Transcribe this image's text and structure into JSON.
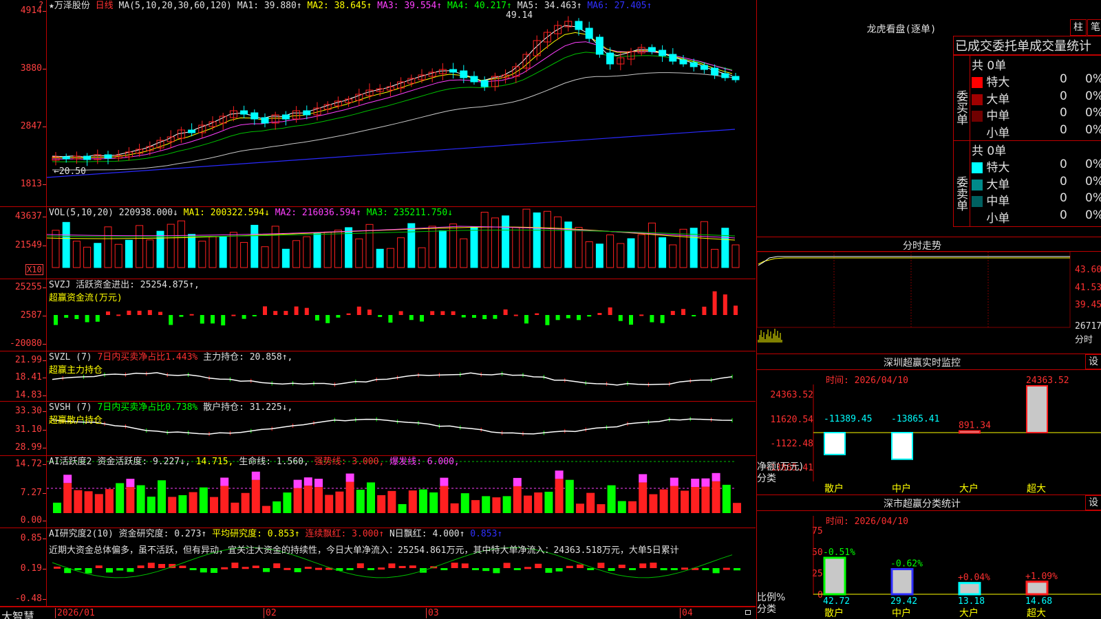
{
  "stock": {
    "star": "★",
    "name": "万泽股份",
    "period": "日线"
  },
  "kline": {
    "ma_label": "MA(5,10,20,30,60,120)",
    "ma1": "MA1: 39.880↑",
    "ma2": "MA2: 38.645↑",
    "ma3": "MA3: 39.554↑",
    "ma4": "MA4: 40.217↑",
    "ma5": "MA5: 34.463↑",
    "ma6": "MA6: 27.405↑",
    "yticks": [
      "4914",
      "3880",
      "2847",
      "1813"
    ],
    "top_icon": "?",
    "high_mark": "49.14",
    "low_mark": "←20.50"
  },
  "vol": {
    "label": "VOL(5,10,20)",
    "value": "220938.000↓",
    "ma1": "MA1: 200322.594↓",
    "ma2": "MA2: 216036.594↑",
    "ma3": "MA3: 235211.750↓",
    "yticks": [
      "43637",
      "21549"
    ],
    "unit": "X10"
  },
  "svzj": {
    "line1": "SVZJ  活跃资金进出: 25254.875↑,",
    "line2": "超赢资金流(万元)",
    "yticks": [
      "25255",
      "2587",
      "-20080"
    ]
  },
  "svzl": {
    "label": "SVZL (7)",
    "desc": "7日内买卖净占比1.443%",
    "value": "主力持仓: 20.858↑,",
    "line2": "超赢主力持仓",
    "yticks": [
      "21.99",
      "18.41",
      "14.83"
    ]
  },
  "svsh": {
    "label": "SVSH (7)",
    "desc": "7日内买卖净占比0.738%",
    "value": "散户持仓: 31.225↓,",
    "line2": "超赢散户持仓",
    "yticks": [
      "33.30",
      "31.10",
      "28.99"
    ]
  },
  "ai_active": {
    "label": "AI活跃度2",
    "v1": "资金活跃度: 9.227↓,",
    "v2": "14.715,",
    "v3": "生命线: 1.560,",
    "v4": "强势线: 3.000,",
    "v5": "爆发线: 6.000,",
    "yticks": [
      "14.72",
      "7.27",
      "0.00"
    ]
  },
  "ai_research": {
    "label": "AI研究度2(10)",
    "v1": "资金研究度: 0.273↑",
    "v2": "平均研究度: 0.853↑",
    "v3": "连续飘红: 3.000↑",
    "v4": "N日飘红: 4.000↑",
    "v5": "0.853↑",
    "comment": "近期大资金总体偏多，虽不活跃，但有异动，宜关注大资金的持续性，今日大单净流入：25254.861万元，其中特大单净流入：24363.518万元，大单5日累计",
    "yticks": [
      "0.85",
      "0.19",
      "-0.48"
    ]
  },
  "xaxis": {
    "corner": "大智慧",
    "dates": [
      "2026/01",
      "02",
      "03",
      "04"
    ]
  },
  "lhkp": {
    "title": "龙虎看盘(逐单)",
    "btn1": "柱",
    "btn2": "笔",
    "tabs": "已成交委托单成交量统计",
    "buy_label": "委买单",
    "sell_label": "委卖单",
    "buy_total": "共 0单",
    "sell_total": "共 0单",
    "buy_rows": [
      {
        "name": "特大",
        "n": "0",
        "p": "0%",
        "color": "#ff0000"
      },
      {
        "name": "大单",
        "n": "0",
        "p": "0%",
        "color": "#a00000"
      },
      {
        "name": "中单",
        "n": "0",
        "p": "0%",
        "color": "#700000"
      },
      {
        "name": "小单",
        "n": "0",
        "p": "0%",
        "color": "#000000"
      }
    ],
    "sell_rows": [
      {
        "name": "特大",
        "n": "0",
        "p": "0%",
        "color": "#00ffff"
      },
      {
        "name": "大单",
        "n": "0",
        "p": "0%",
        "color": "#008a8a"
      },
      {
        "name": "中单",
        "n": "0",
        "p": "0%",
        "color": "#006060"
      },
      {
        "name": "小单",
        "n": "0",
        "p": "0%",
        "color": "#000000"
      }
    ]
  },
  "fenshi": {
    "title": "分时走势",
    "prices": [
      "43.60",
      "41.53",
      "39.45"
    ],
    "vol": "26717",
    "vol_label": "分时"
  },
  "sz_monitor": {
    "title": "深圳超赢实时监控",
    "set": "设",
    "time": "时间: 2026/04/10",
    "yticks": [
      "24363.52",
      "11620.54",
      "-1122.48",
      "-13865.41"
    ],
    "ylabel": "净额(万元)",
    "xlabel": "分类",
    "cats": [
      "散户",
      "中户",
      "大户",
      "超大"
    ],
    "values": [
      "-11389.45",
      "-13865.41",
      "891.34",
      "24363.52"
    ]
  },
  "sz_class": {
    "title": "深市超赢分类统计",
    "set": "设",
    "time": "时间: 2026/04/10",
    "yticks": [
      "75",
      "50",
      "25",
      "0"
    ],
    "ylabel": "比例%",
    "xlabel": "分类",
    "cats": [
      "散户",
      "中户",
      "大户",
      "超大"
    ],
    "pcts": [
      "-0.51%",
      "-0.62%",
      "+0.04%",
      "+1.09%"
    ],
    "values": [
      "42.72",
      "29.42",
      "13.18",
      "14.68"
    ]
  }
}
